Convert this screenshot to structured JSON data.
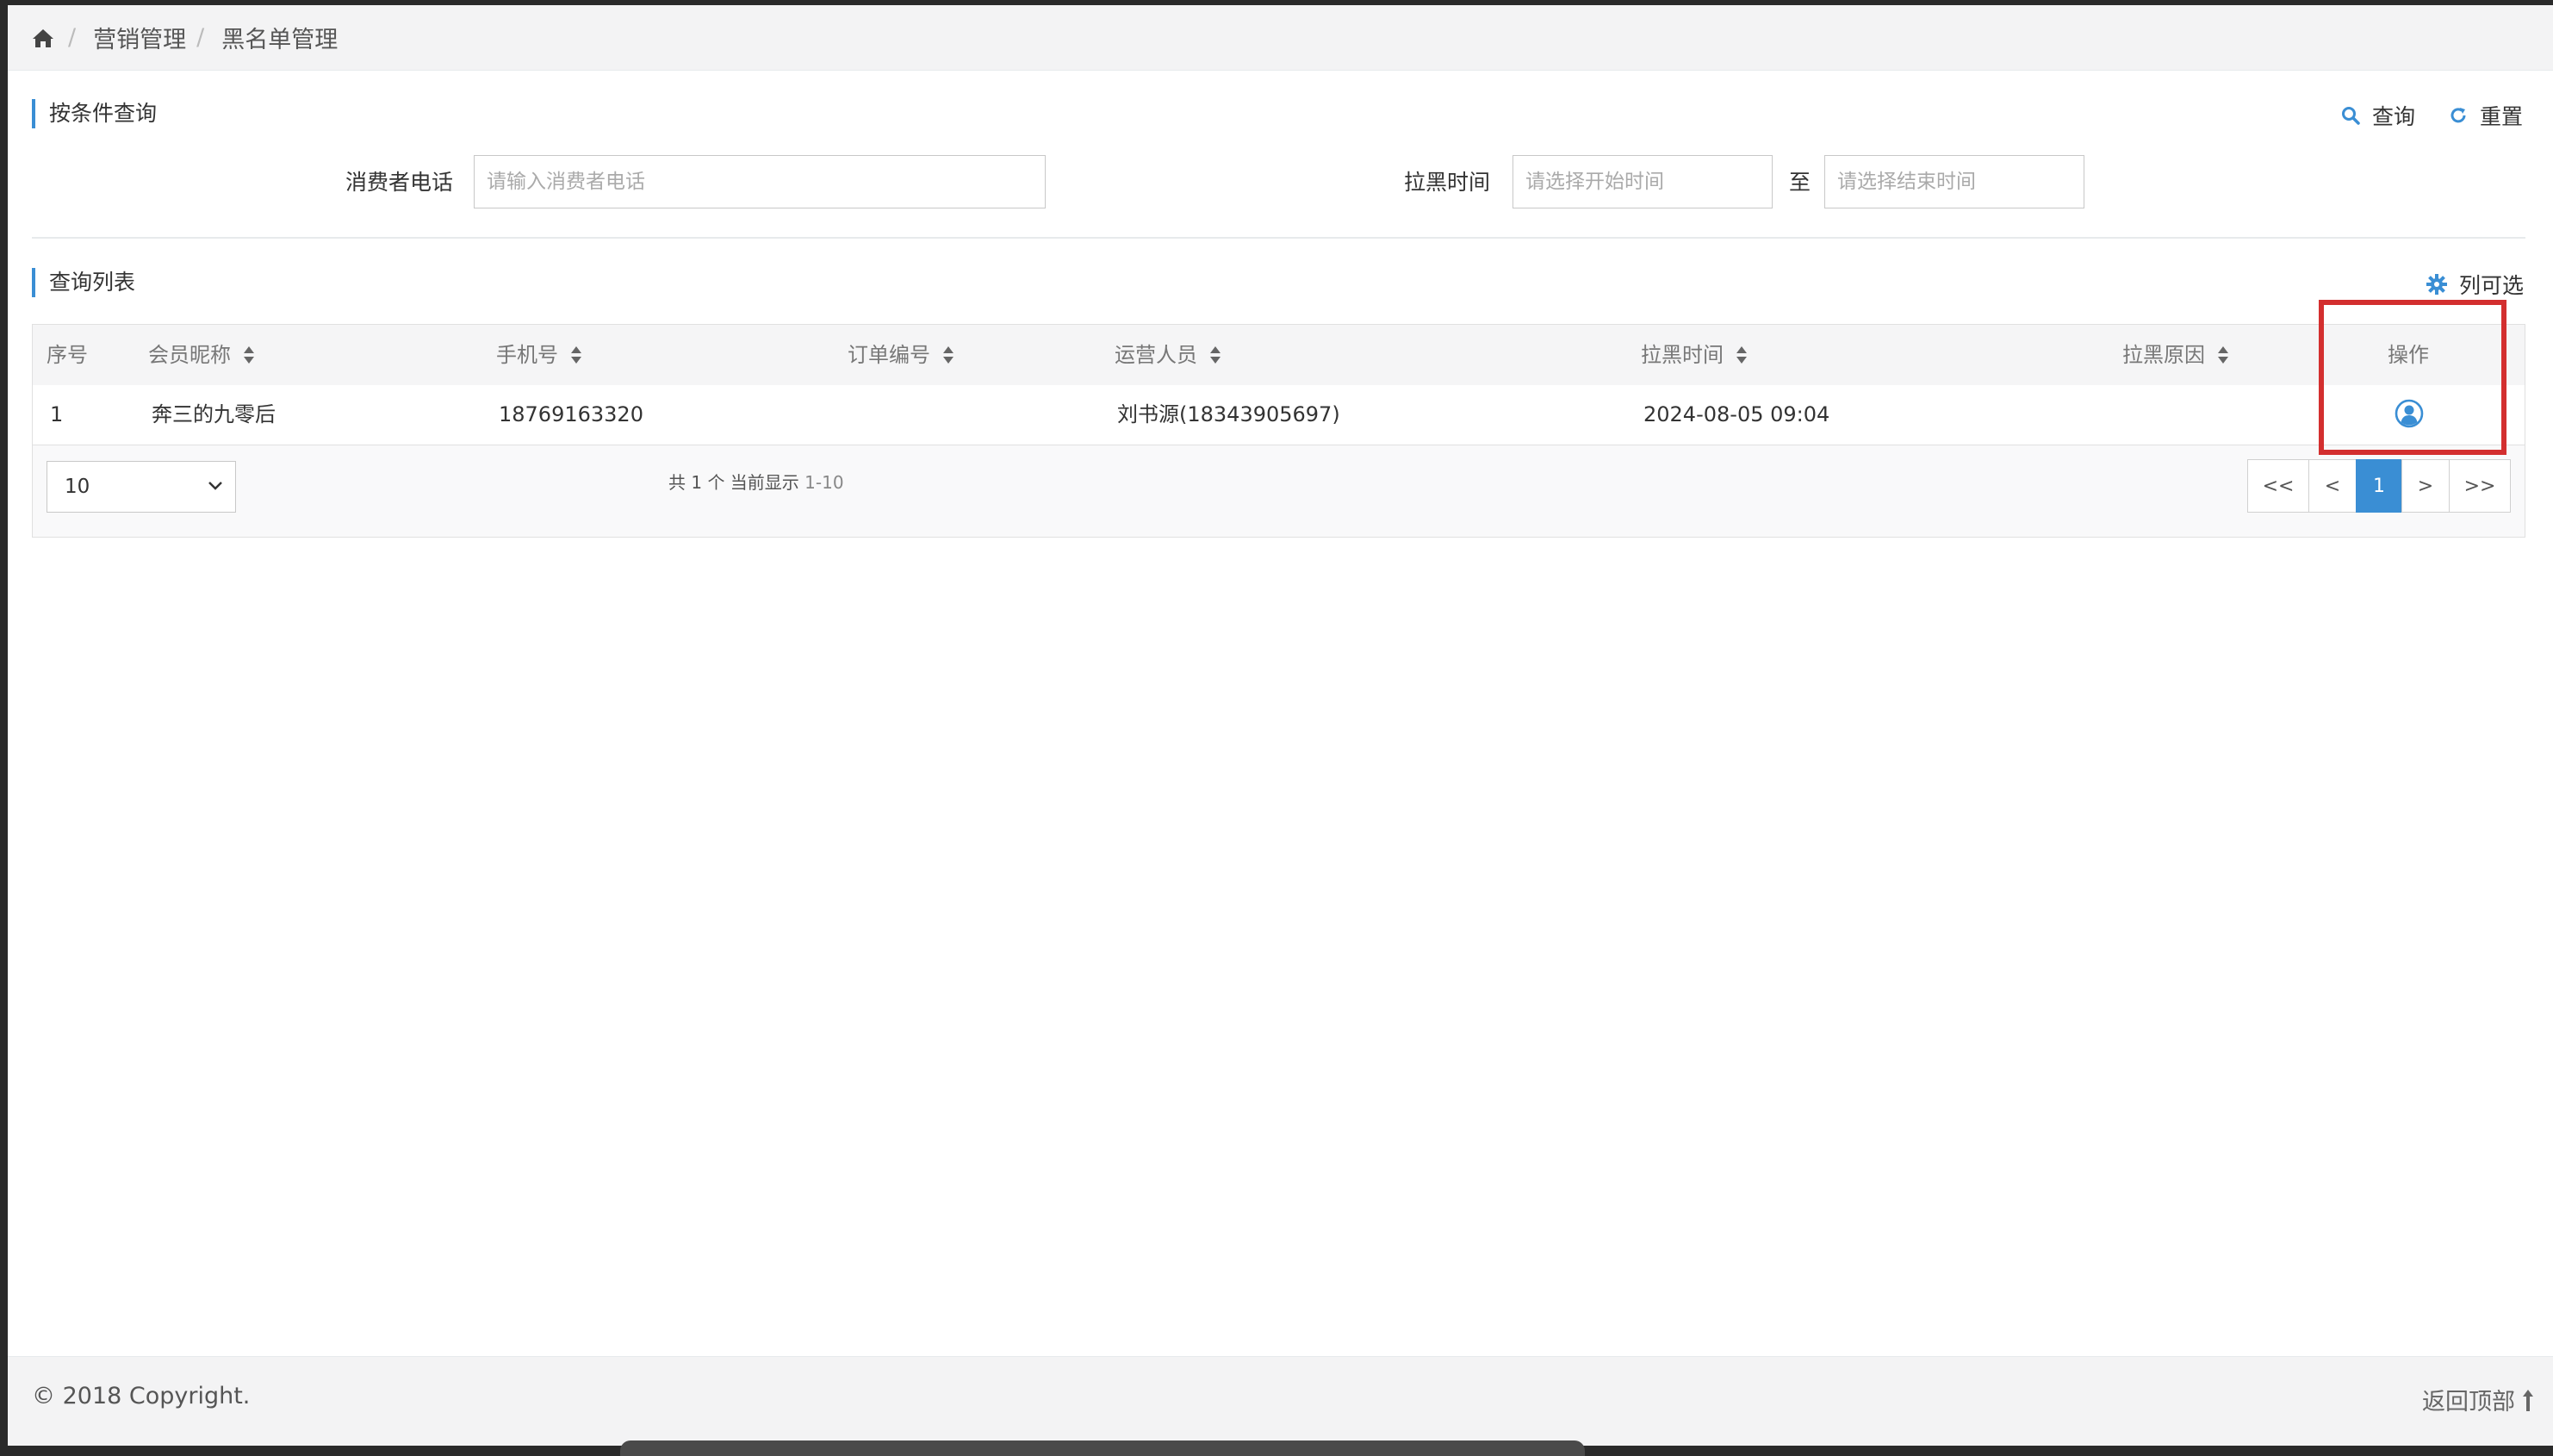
{
  "breadcrumb": {
    "items": [
      "营销管理",
      "黑名单管理"
    ],
    "separator": "/"
  },
  "search_section": {
    "title": "按条件查询",
    "query_label": "查询",
    "reset_label": "重置",
    "phone_label": "消费者电话",
    "phone_placeholder": "请输入消费者电话",
    "time_label": "拉黑时间",
    "start_placeholder": "请选择开始时间",
    "to_label": "至",
    "end_placeholder": "请选择结束时间"
  },
  "list_section": {
    "title": "查询列表",
    "columns_label": "列可选"
  },
  "table": {
    "headers": {
      "index": "序号",
      "nickname": "会员昵称",
      "phone": "手机号",
      "order_no": "订单编号",
      "operator": "运营人员",
      "blacklist_time": "拉黑时间",
      "reason": "拉黑原因",
      "action": "操作"
    },
    "rows": [
      {
        "index": "1",
        "nickname": "奔三的九零后",
        "phone": "18769163320",
        "order_no": "",
        "operator": "刘书源(18343905697)",
        "blacklist_time": "2024-08-05 09:04",
        "reason": ""
      }
    ]
  },
  "pagination": {
    "page_size": "10",
    "info_prefix": "共 1 个 当前显示",
    "info_range": "1-10",
    "first": "<<",
    "prev": "<",
    "current": "1",
    "next": ">",
    "last": ">>"
  },
  "footer": {
    "copyright": "© 2018 Copyright.",
    "back_to_top": "返回顶部"
  },
  "colors": {
    "accent": "#3a8ed4",
    "highlight": "#d32f2f"
  }
}
